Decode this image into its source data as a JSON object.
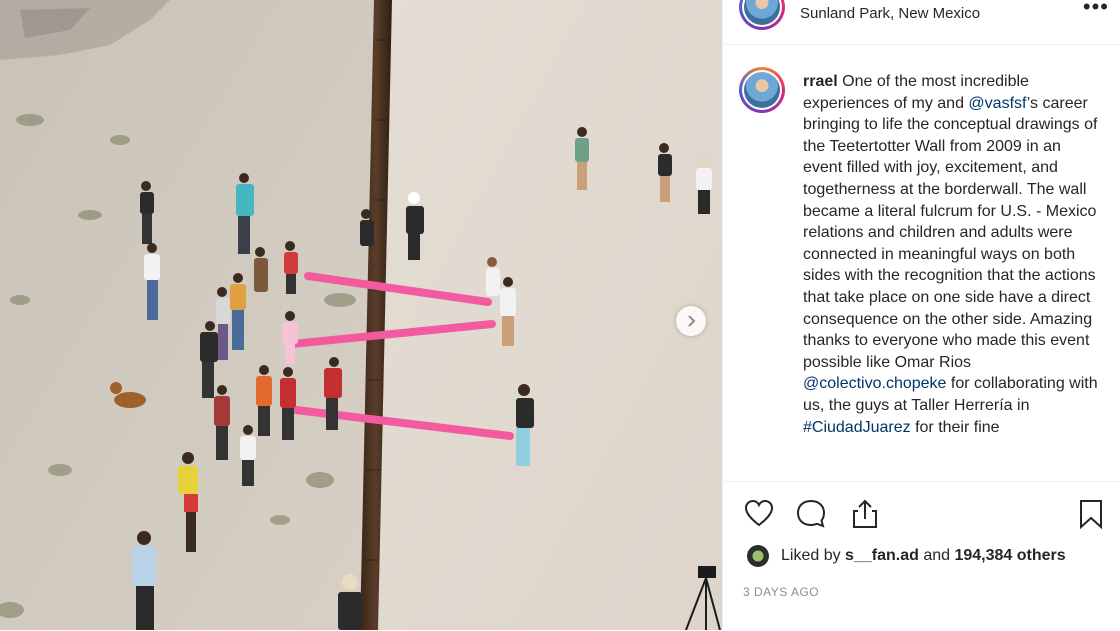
{
  "header": {
    "location": "Sunland Park, New Mexico",
    "more_icon": "more-horizontal-icon"
  },
  "caption": {
    "username": "rrael",
    "text_1": " One of the most incredible experiences of my and ",
    "mention_1": "@vasfsf",
    "text_2": "’s career bringing to life the conceptual drawings of the Teetertotter Wall from 2009 in an event filled with joy, excitement, and togetherness at the borderwall. The wall became a literal fulcrum for U.S. - Mexico relations and children and adults were connected in meaningful ways on both sides with the recognition that the actions that take place on one side have a direct consequence on the other side. Amazing thanks to everyone who made this event possible like Omar Rios ",
    "mention_2": "@colectivo.chopeke",
    "text_3": " for collaborating with us, the guys at Taller Herrería in ",
    "hashtag_1": "#CiudadJuarez",
    "text_4": " for their fine"
  },
  "actions": {
    "like_icon": "heart-icon",
    "comment_icon": "comment-icon",
    "share_icon": "share-icon",
    "save_icon": "bookmark-icon"
  },
  "likes": {
    "prefix": "Liked by",
    "user": "s__fan.ad",
    "conjunction": "and",
    "count_text": "194,384 others"
  },
  "timestamp": "3 DAYS AGO",
  "colors": {
    "seesaw_pink": "#f35aa0",
    "link_blue": "#003569",
    "ground": "#d9d2c7",
    "wall": "#4a3324"
  }
}
